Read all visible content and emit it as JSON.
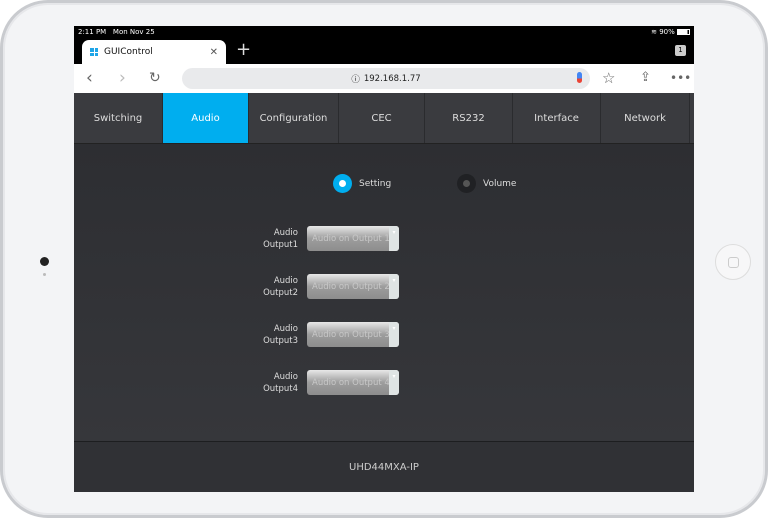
{
  "status": {
    "time": "2:11 PM",
    "date": "Mon Nov 25",
    "battery": "90%"
  },
  "browser": {
    "tab_title": "GUIControl",
    "tab_count": "1",
    "url": "192.168.1.77"
  },
  "nav": {
    "items": [
      "Switching",
      "Audio",
      "Configuration",
      "CEC",
      "RS232",
      "Interface",
      "Network"
    ],
    "active": "Audio"
  },
  "mode": {
    "options": [
      {
        "label": "Setting",
        "selected": true
      },
      {
        "label": "Volume",
        "selected": false
      }
    ]
  },
  "outputs": [
    {
      "label1": "Audio",
      "label2": "Output1",
      "value": "Audio on Output 1"
    },
    {
      "label1": "Audio",
      "label2": "Output2",
      "value": "Audio on Output 2"
    },
    {
      "label1": "Audio",
      "label2": "Output3",
      "value": "Audio on Output 3"
    },
    {
      "label1": "Audio",
      "label2": "Output4",
      "value": "Audio on Output 4"
    }
  ],
  "footer": {
    "model": "UHD44MXA-IP"
  },
  "colors": {
    "accent": "#00aeef"
  }
}
